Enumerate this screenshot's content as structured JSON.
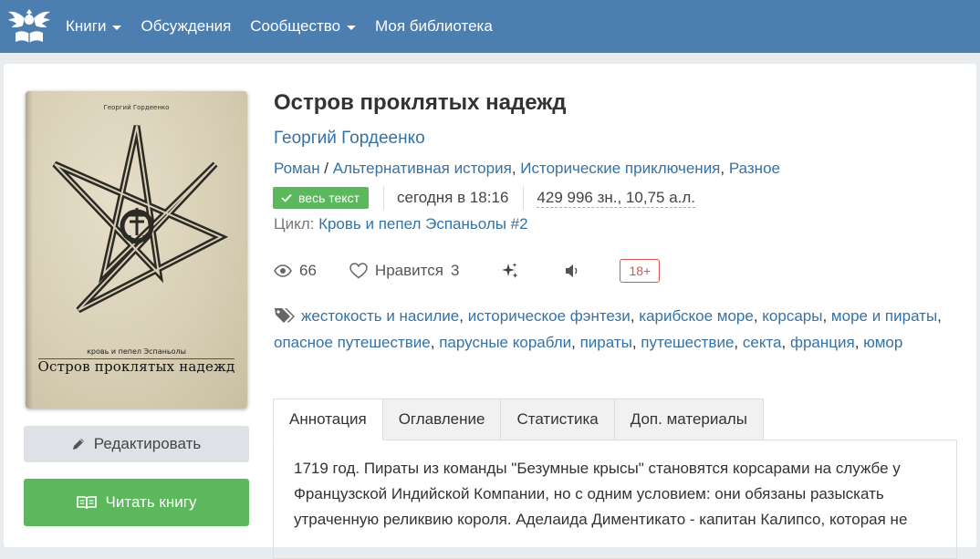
{
  "nav": {
    "items": [
      {
        "label": "Книги",
        "dropdown": true
      },
      {
        "label": "Обсуждения",
        "dropdown": false
      },
      {
        "label": "Сообщество",
        "dropdown": true
      },
      {
        "label": "Моя библиотека",
        "dropdown": false
      }
    ]
  },
  "book": {
    "cover": {
      "author": "Георгий Гордеенко",
      "series": "кровь и пепел Эспаньолы",
      "title": "Остров проклятых надежд"
    },
    "title": "Остров проклятых надежд",
    "author": "Георгий Гордеенко",
    "genres": [
      "Роман",
      "Альтернативная история",
      "Исторические приключения",
      "Разное"
    ],
    "genre_sep_1": " / ",
    "genre_sep_2": ", ",
    "status_badge": "весь текст",
    "updated": "сегодня в 18:16",
    "size": "429 996 зн., 10,75 а.л.",
    "cycle_label": "Цикл: ",
    "cycle": "Кровь и пепел Эспаньолы #2",
    "views": "66",
    "likes_label": "Нравится",
    "likes": "3",
    "age_rating": "18+",
    "tags": [
      "жестокость и насилие",
      "историческое фэнтези",
      "карибское море",
      "корсары",
      "море и пираты",
      "опасное путешествие",
      "парусные корабли",
      "пираты",
      "путешествие",
      "секта",
      "франция",
      "юмор"
    ]
  },
  "buttons": {
    "edit": "Редактировать",
    "read": "Читать книгу"
  },
  "tabs": [
    {
      "label": "Аннотация",
      "active": true
    },
    {
      "label": "Оглавление",
      "active": false
    },
    {
      "label": "Статистика",
      "active": false
    },
    {
      "label": "Доп. материалы",
      "active": false
    }
  ],
  "annotation": "1719 год. Пираты из команды \"Безумные крысы\" становятся корсарами на службе у Французской Индийской Компании, но с одним условием: они обязаны разыскать утраченную реликвию короля. Аделаида Диментикато - капитан Калипсо, которая не",
  "colors": {
    "navbar": "#4d7eb0",
    "link": "#3572a5",
    "success": "#5cb85c",
    "danger": "#d9534f"
  }
}
